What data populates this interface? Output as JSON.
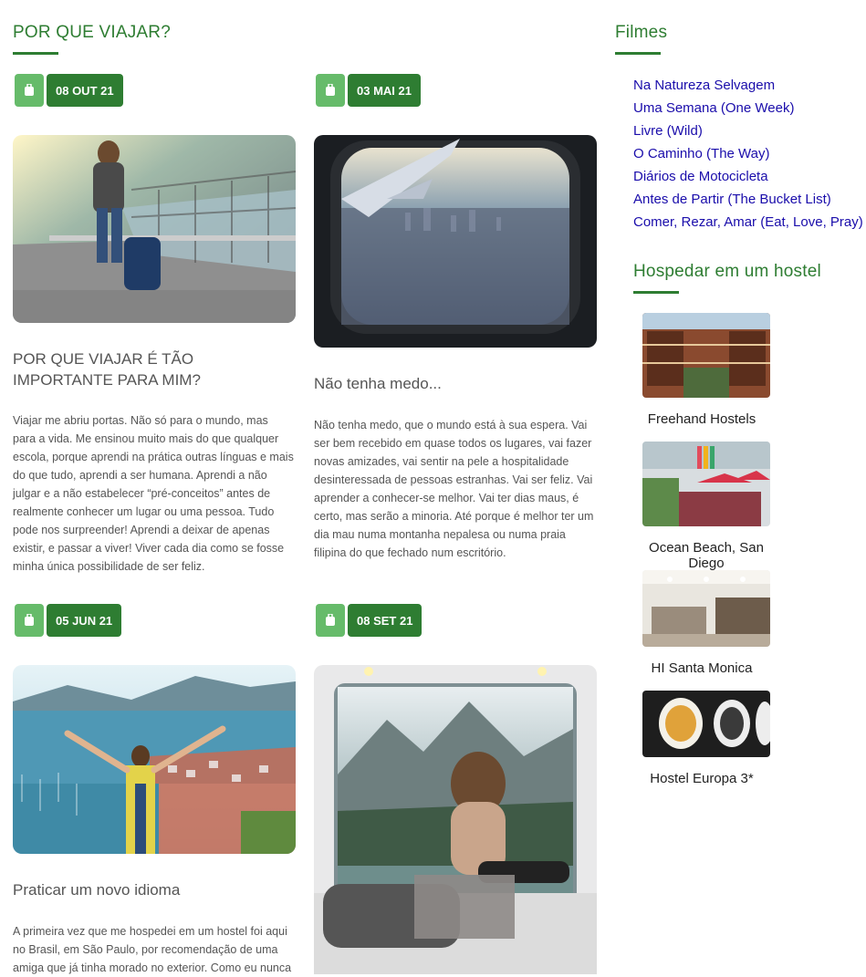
{
  "main": {
    "section_title": "POR QUE VIAJAR?",
    "posts": [
      {
        "date": "08 OUT 21",
        "title": "POR QUE VIAJAR É TÃO IMPORTANTE PARA MIM?",
        "text": "Viajar me abriu portas. Não só para o mundo, mas para a vida. Me ensinou muito mais do que qualquer escola, porque aprendi na prática outras línguas e mais do que tudo, aprendi a ser humana. Aprendi a não julgar e a não estabelecer “pré-conceitos” antes de realmente conhecer um lugar ou uma pessoa. Tudo pode nos surpreender! Aprendi a deixar de apenas existir, e passar a viver! Viver cada dia como se fosse minha única possibilidade de ser feliz."
      },
      {
        "date": "03 MAI 21",
        "title": "Não tenha medo...",
        "text": "Não tenha medo, que o mundo está à sua espera. Vai ser bem recebido em quase todos os lugares, vai fazer novas amizades, vai sentir na pele a hospitalidade desinteressada de pessoas estranhas. Vai ser feliz. Vai aprender a conhecer-se melhor. Vai ter dias maus, é certo, mas serão a minoria. Até porque é melhor ter um dia mau numa montanha nepalesa ou numa praia filipina do que fechado num escritório."
      },
      {
        "date": "05 JUN 21",
        "title": "Praticar um novo idioma",
        "text": "A primeira vez que me hospedei em um hostel foi aqui no Brasil, em São Paulo, por recomendação de uma amiga que já tinha morado no exterior. Como eu nunca"
      },
      {
        "date": "08 SET 21",
        "title": "",
        "text": ""
      }
    ]
  },
  "sidebar": {
    "films_title": "Filmes",
    "films": [
      "Na Natureza Selvagem",
      "Uma Semana (One Week)",
      "Livre (Wild)",
      "O Caminho (The Way)",
      "Diários de Motocicleta",
      "Antes de Partir (The Bucket List)",
      "Comer, Rezar, Amar (Eat, Love, Pray)"
    ],
    "hostels_title": "Hospedar em um hostel",
    "hostels": [
      "Freehand Hostels",
      "Ocean Beach, San Diego",
      "HI Santa Monica",
      "Hostel Europa 3*"
    ]
  },
  "colors": {
    "accent": "#2e7d32",
    "accent_light": "#66bb6a",
    "link": "#1a0dab"
  }
}
